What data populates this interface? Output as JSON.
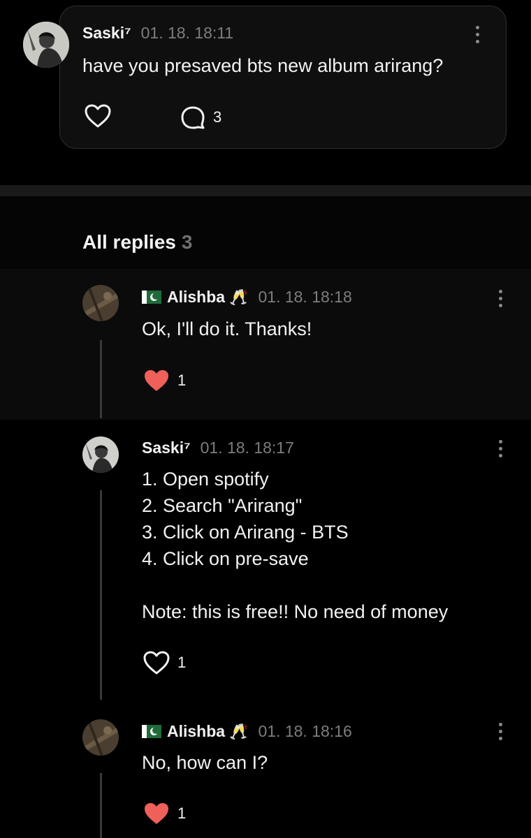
{
  "post": {
    "author": "Saski⁷",
    "time": "01. 18. 18:11",
    "text": "have you presaved bts new album arirang?",
    "comment_count": "3",
    "icons": {
      "like": "heart-outline-icon",
      "comment": "speech-bubble-icon",
      "more": "kebab-menu-icon"
    }
  },
  "replies_header": {
    "label": "All replies",
    "count": "3"
  },
  "replies": [
    {
      "author": "Alishba",
      "flag": "pakistan-flag-icon",
      "emoji": "🥂",
      "time": "01. 18. 18:18",
      "text": "Ok, I'll do it. Thanks!",
      "likes": "1",
      "liked": true
    },
    {
      "author": "Saski⁷",
      "time": "01. 18. 18:17",
      "text": "1. Open spotify\n2. Search \"Arirang\"\n3. Click on Arirang - BTS\n4. Click on pre-save\n\nNote: this is free!! No need of money",
      "likes": "1",
      "liked": false
    },
    {
      "author": "Alishba",
      "flag": "pakistan-flag-icon",
      "emoji": "🥂",
      "time": "01. 18. 18:16",
      "text": "No, how can I?",
      "likes": "1",
      "liked": true
    }
  ],
  "colors": {
    "background": "#000000",
    "card": "#0f0f0f",
    "liked_heart": "#f0605a",
    "muted_text": "#7d7d7d"
  }
}
